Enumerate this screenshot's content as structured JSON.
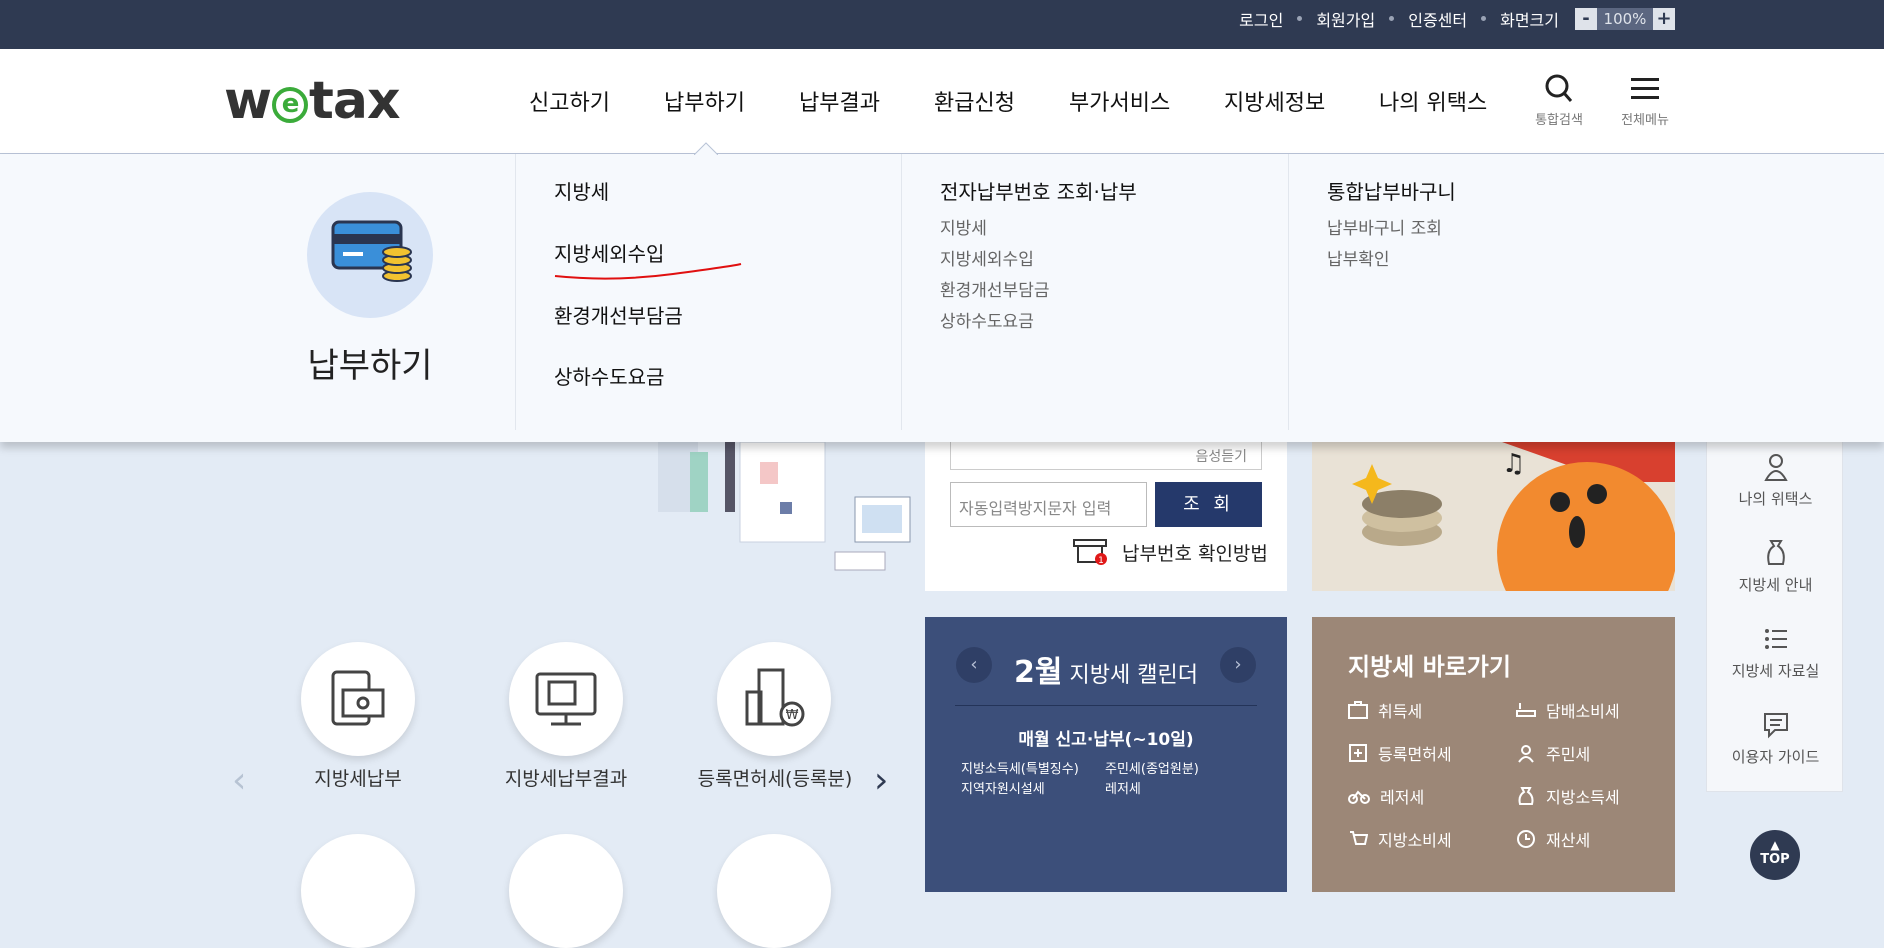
{
  "topbar": {
    "links": [
      "로그인",
      "회원가입",
      "인증센터",
      "화면크기"
    ],
    "zoom_minus": "-",
    "zoom_value": "100%",
    "zoom_plus": "+"
  },
  "header": {
    "logo_left": "w",
    "logo_e": "e",
    "logo_right": "tax",
    "nav": [
      "신고하기",
      "납부하기",
      "납부결과",
      "환급신청",
      "부가서비스",
      "지방세정보",
      "나의 위택스"
    ],
    "search_label": "통합검색",
    "menu_label": "전체메뉴"
  },
  "mega": {
    "title": "납부하기",
    "col1": [
      "지방세",
      "지방세외수입",
      "환경개선부담금",
      "상하수도요금"
    ],
    "col2_heading": "전자납부번호 조회·납부",
    "col2_items": [
      "지방세",
      "지방세외수입",
      "환경개선부담금",
      "상하수도요금"
    ],
    "col3_heading": "통합납부바구니",
    "col3_items": [
      "납부바구니 조회",
      "납부확인"
    ]
  },
  "lookup": {
    "captcha_placeholder": "자동입력방지문자 입력",
    "submit_label": "조 회",
    "howto_label": "납부번호 확인방법",
    "partial_text": "음성듣기"
  },
  "calendar": {
    "month": "2월",
    "title_suffix": " 지방세 캘린더",
    "subtitle": "매월 신고·납부(~10일)",
    "items": [
      "지방소득세(특별징수)",
      "주민세(종업원분)",
      "지역자원시설세",
      "레저세"
    ]
  },
  "shortcut": {
    "title": "지방세 바로가기",
    "items": [
      "취득세",
      "담배소비세",
      "등록면허세",
      "주민세",
      "레저세",
      "지방소득세",
      "지방소비세",
      "재산세"
    ]
  },
  "services": [
    "지방세납부",
    "지방세납부결과",
    "등록면허세(등록분)"
  ],
  "sidebar": [
    "나의 위택스",
    "지방세 안내",
    "지방세 자료실",
    "이용자 가이드"
  ],
  "top_button": "TOP",
  "colors": {
    "topbar": "#2f3a52",
    "navy_button": "#25396b",
    "calendar": "#3c4f7a",
    "shortcut": "#9c8777",
    "logo_green": "#3bab3a"
  }
}
